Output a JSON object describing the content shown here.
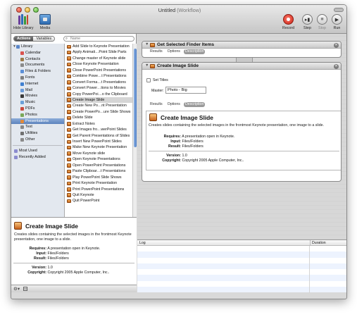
{
  "window": {
    "title": "Untitled",
    "subtitle": "(Workflow)"
  },
  "toolbar": {
    "hide_library": "Hide Library",
    "media": "Media",
    "record": "Record",
    "step": "Step",
    "stop": "Stop",
    "run": "Run"
  },
  "library": {
    "tab_actions": "Actions",
    "tab_variables": "Variables",
    "search_placeholder": "Name",
    "categories": [
      {
        "label": "Library",
        "color": "#5a86c8"
      },
      {
        "label": "Calendar",
        "color": "#d9534f"
      },
      {
        "label": "Contacts",
        "color": "#9b7b4a"
      },
      {
        "label": "Documents",
        "color": "#8a8a8a"
      },
      {
        "label": "Files & Folders",
        "color": "#5b8fd6"
      },
      {
        "label": "Fonts",
        "color": "#7f7f7f"
      },
      {
        "label": "Internet",
        "color": "#3f7fd0"
      },
      {
        "label": "Mail",
        "color": "#6a9ad8"
      },
      {
        "label": "Movies",
        "color": "#3a3a3a"
      },
      {
        "label": "Music",
        "color": "#6aa0d8"
      },
      {
        "label": "PDFs",
        "color": "#c94a3d"
      },
      {
        "label": "Photos",
        "color": "#7aa85a"
      },
      {
        "label": "Presentations",
        "color": "#e08a3a"
      },
      {
        "label": "Text",
        "color": "#888888"
      },
      {
        "label": "Utilities",
        "color": "#707070"
      },
      {
        "label": "Other",
        "color": "#8a8a8a"
      }
    ],
    "smart_groups": [
      {
        "label": "Most Used",
        "color": "#8c8ccf"
      },
      {
        "label": "Recently Added",
        "color": "#8c8ccf"
      }
    ],
    "actions": [
      "Add Slide to Keynote Presentation",
      "Apply Animati…Point Slide Parts",
      "Change master of Keynote slide",
      "Close Keynote Presentation",
      "Close PowerPoint Presentations",
      "Combine Powe…t Presentations",
      "Convert Forma…t Presentations",
      "Convert Power…tions to Movies",
      "Copy PowerPoi…o the Clipboard",
      "Create Image Slide",
      "Create New Po…nt Presentation",
      "Create PowerPo…ure Slide Shows",
      "Delete Slide",
      "Extract Notes",
      "Get Images fro…werPoint Slides",
      "Get Parent Presentations of Slides",
      "Insert New PowerPoint Slides",
      "Make New Keynote Presentation",
      "Move Keynote slide",
      "Open Keynote Presentations",
      "Open PowerPoint Presentations",
      "Paste Clipboar…t Presentations",
      "Play PowerPoint Slide Shows",
      "Print Keynote Presentation",
      "Print PowerPoint Presentations",
      "Quit Keynote",
      "Quit PowerPoint"
    ]
  },
  "description": {
    "title": "Create Image Slide",
    "text": "Creates slides containing the selected images in the frontmost Keynote presentation, one image to a slide.",
    "requires_label": "Requires:",
    "requires": "A presentation open in Keynote.",
    "input_label": "Input:",
    "input": "Files/Folders",
    "result_label": "Result:",
    "result": "Files/Folders",
    "version_label": "Version:",
    "version": "1.0",
    "copyright_label": "Copyright:",
    "copyright": "Copyright 2005 Apple Computer, Inc.."
  },
  "workflow": {
    "action1": {
      "title": "Get Selected Finder Items",
      "tabs": [
        "Results",
        "Options",
        "Description"
      ]
    },
    "action2": {
      "title": "Create Image Slide",
      "set_titles_label": "Set Titles",
      "master_label": "Master:",
      "master_value": "Photo - Big",
      "tabs": [
        "Results",
        "Options",
        "Description"
      ]
    }
  },
  "log": {
    "col_log": "Log",
    "col_duration": "Duration"
  }
}
